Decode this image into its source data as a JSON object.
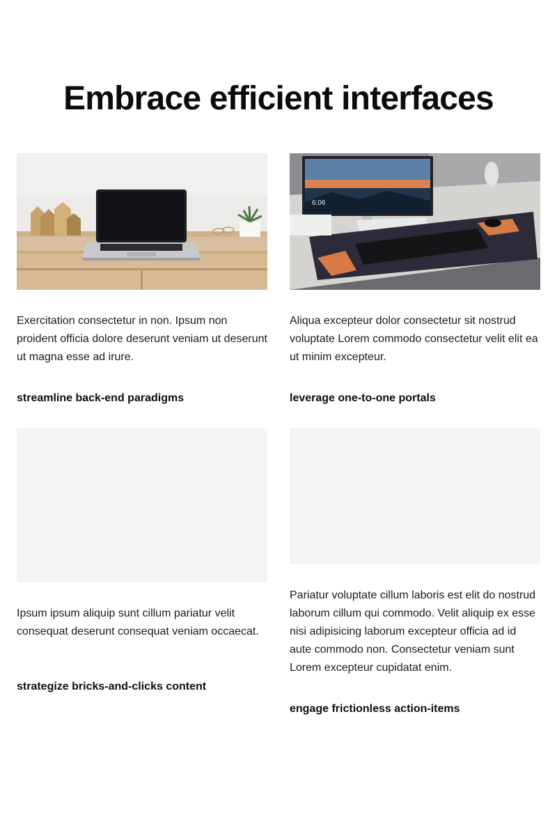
{
  "page": {
    "title": "Embrace efficient interfaces"
  },
  "cards": [
    {
      "image_alt": "laptop-on-wooden-desk-photo",
      "text": "Exercitation consectetur in non. Ipsum non proident officia dolore deserunt veniam ut deserunt ut magna esse ad irure.",
      "title": "streamline back-end paradigms"
    },
    {
      "image_alt": "desktop-monitor-keyboard-setup-photo",
      "text": "Aliqua excepteur dolor consectetur sit nostrud voluptate Lorem commodo consectetur velit elit ea ut minim excepteur.",
      "title": "leverage one-to-one portals"
    },
    {
      "image_alt": "image-placeholder",
      "text": "Ipsum ipsum aliquip sunt cillum pariatur velit consequat deserunt consequat veniam occaecat.",
      "title": "strategize bricks-and-clicks content"
    },
    {
      "image_alt": "image-placeholder",
      "text": "Pariatur voluptate cillum laboris est elit do nostrud laborum cillum qui commodo. Velit aliquip ex esse nisi adipisicing laborum excepteur officia ad id aute commodo non. Consectetur veniam sunt Lorem excepteur cupidatat enim.",
      "title": "engage frictionless action-items"
    }
  ],
  "colors": {
    "background": "#ffffff",
    "placeholder": "#f3f4f6",
    "text": "#111111"
  }
}
